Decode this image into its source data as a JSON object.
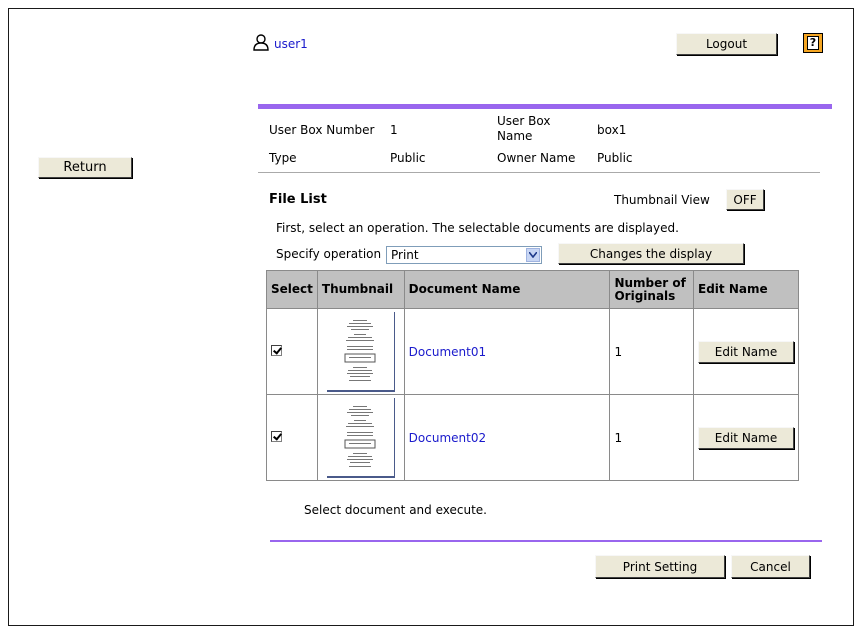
{
  "header": {
    "user_name": "user1",
    "logout_label": "Logout",
    "help_glyph": "?"
  },
  "nav": {
    "return_label": "Return"
  },
  "box_info": {
    "box_number_label": "User Box Number",
    "box_number_value": "1",
    "box_name_label_line1": "User Box",
    "box_name_label_line2": "Name",
    "box_name_value": "box1",
    "type_label": "Type",
    "type_value": "Public",
    "owner_label": "Owner Name",
    "owner_value": "Public"
  },
  "file_list": {
    "title": "File List",
    "thumbnail_view_label": "Thumbnail View",
    "thumbnail_toggle_label": "OFF",
    "instruction": "First, select an operation. The selectable documents are displayed.",
    "operation_label": "Specify operation",
    "operation_value": "Print",
    "change_display_label": "Changes the display",
    "columns": {
      "select": "Select",
      "thumbnail": "Thumbnail",
      "document_name": "Document Name",
      "originals_line1": "Number of",
      "originals_line2": "Originals",
      "edit_name": "Edit Name"
    },
    "rows": [
      {
        "checked": true,
        "document_name": "Document01",
        "originals": "1",
        "edit_label": "Edit Name"
      },
      {
        "checked": true,
        "document_name": "Document02",
        "originals": "1",
        "edit_label": "Edit Name"
      }
    ],
    "footer_message": "Select document and execute."
  },
  "actions": {
    "print_setting_label": "Print Setting",
    "cancel_label": "Cancel"
  },
  "colors": {
    "accent_bar": "#9966ee",
    "link": "#1a1acc",
    "help_icon_bg": "#f5a623",
    "header_cell_bg": "#c0c0c0"
  }
}
